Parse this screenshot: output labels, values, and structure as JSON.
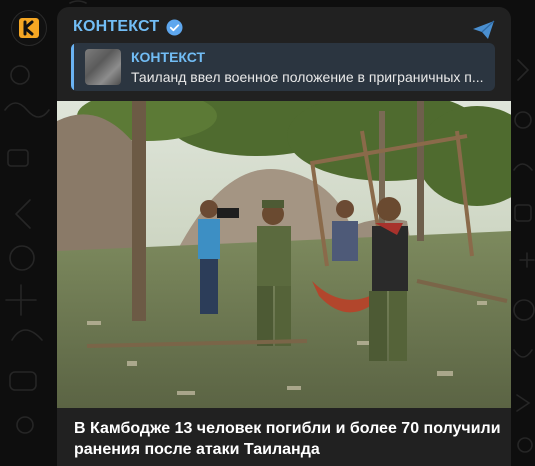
{
  "channel": {
    "name": "КОНТЕКСТ",
    "avatar_letter": "К",
    "avatar_color": "#f5a623",
    "accent": "#72bdf5",
    "verified": true
  },
  "reply": {
    "name": "КОНТЕКСТ",
    "text": "Таиланд ввел военное положение в приграничных п..."
  },
  "post": {
    "caption": "В Камбодже 13 человек погибли и более 70 получили ранения после атаки Таиланда",
    "image": "photo-soldiers-carrying-wounded-person-through-debris"
  },
  "icons": {
    "share": "share-icon",
    "verified": "verified-icon"
  }
}
